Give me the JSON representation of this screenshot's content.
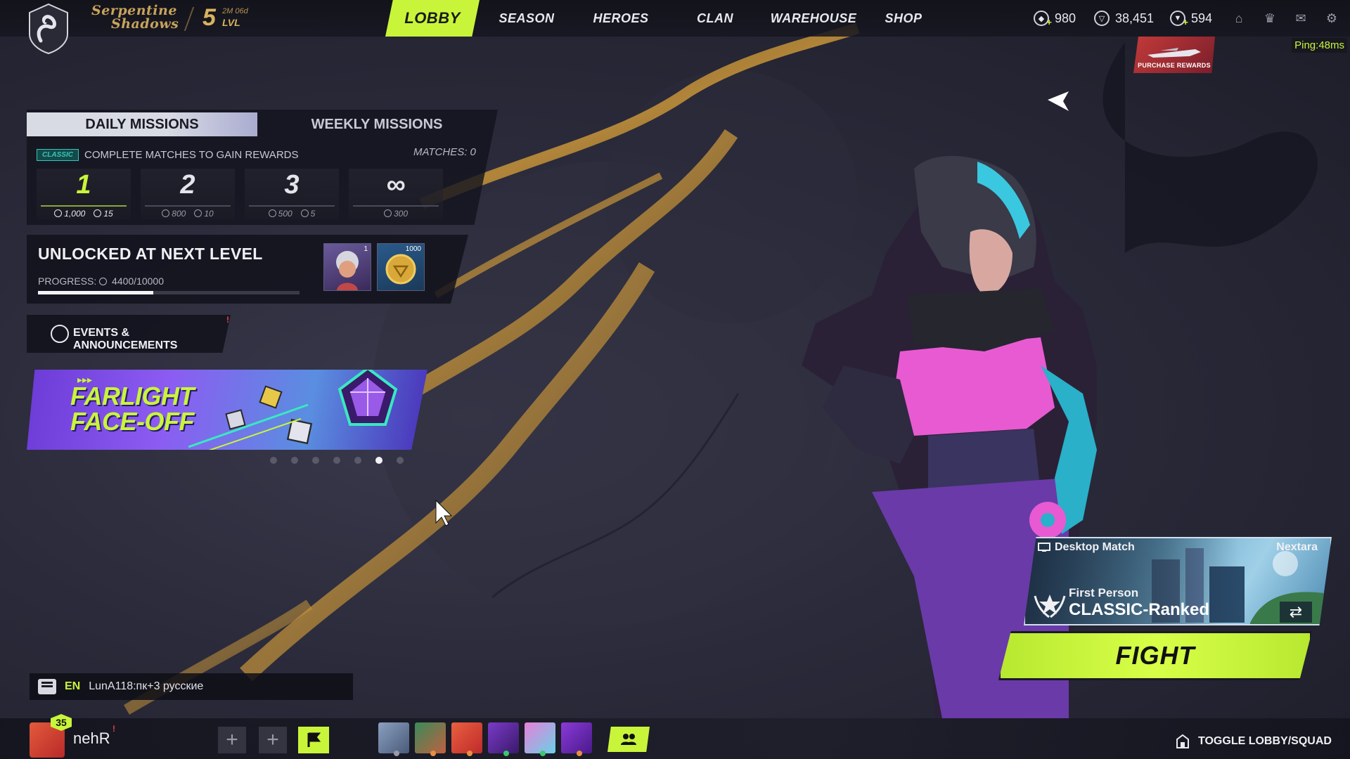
{
  "header": {
    "season_title_line1": "Serpentine",
    "season_title_line2": "Shadows",
    "level": "5",
    "level_time": "2M 06d",
    "level_label": "LVL",
    "nav": [
      "LOBBY",
      "SEASON",
      "HEROES",
      "CLAN",
      "WAREHOUSE",
      "SHOP"
    ],
    "active_nav": "LOBBY",
    "currency_a": "980",
    "currency_b": "38,451",
    "currency_c": "594",
    "ping": "Ping:48ms",
    "purchase_rewards": "PURCHASE REWARDS"
  },
  "missions": {
    "tab_daily": "DAILY MISSIONS",
    "tab_weekly": "WEEKLY MISSIONS",
    "mode_tag": "CLASSIC",
    "description": "COMPLETE MATCHES TO GAIN REWARDS",
    "matches": "MATCHES: 0",
    "tiers": [
      {
        "num": "1",
        "reward_a": "1,000",
        "reward_b": "15"
      },
      {
        "num": "2",
        "reward_a": "800",
        "reward_b": "10"
      },
      {
        "num": "3",
        "reward_a": "500",
        "reward_b": "5"
      },
      {
        "num": "∞",
        "reward_a": "300",
        "reward_b": ""
      }
    ]
  },
  "unlock": {
    "title": "UNLOCKED AT NEXT LEVEL",
    "progress_label": "PROGRESS:",
    "progress_value": "4400/10000",
    "progress_fraction": 0.44,
    "reward1_qty": "1",
    "reward2_qty": "1000"
  },
  "events": {
    "label": "EVENTS & ANNOUNCEMENTS",
    "banner_line1": "FARLIGHT",
    "banner_line2": "FACE-OFF",
    "banner_arrows": "▸▸▸",
    "dot_count": 7,
    "active_dot": 5
  },
  "chat": {
    "lang": "EN",
    "message": "LunA118:пк+3 русские"
  },
  "player": {
    "level": "35",
    "name": "nehR"
  },
  "match": {
    "platform": "Desktop Match",
    "map": "Nextara",
    "perspective": "First Person",
    "mode": "CLASSIC-Ranked",
    "fight_label": "FIGHT"
  },
  "footer": {
    "toggle_label": "TOGGLE LOBBY/SQUAD"
  },
  "colors": {
    "accent": "#c8f53a",
    "gold": "#d8b35f",
    "alert": "#e54545"
  }
}
